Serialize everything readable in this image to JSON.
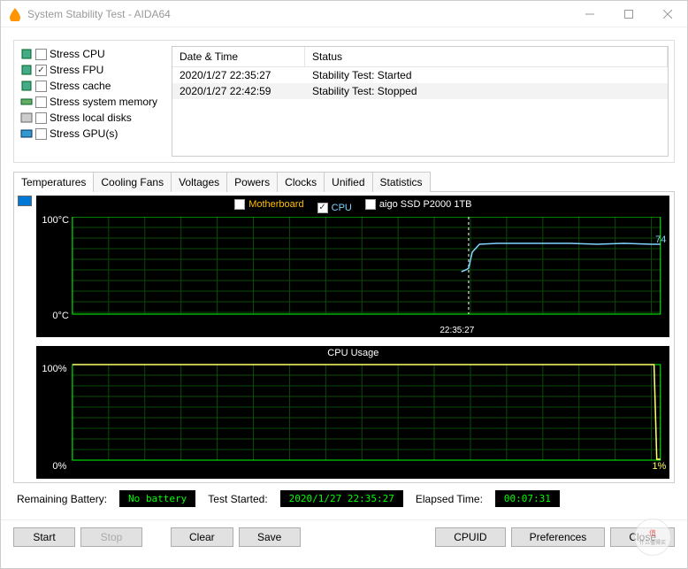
{
  "window": {
    "title": "System Stability Test - AIDA64"
  },
  "stress": {
    "items": [
      {
        "label": "Stress CPU",
        "checked": false
      },
      {
        "label": "Stress FPU",
        "checked": true
      },
      {
        "label": "Stress cache",
        "checked": false
      },
      {
        "label": "Stress system memory",
        "checked": false
      },
      {
        "label": "Stress local disks",
        "checked": false
      },
      {
        "label": "Stress GPU(s)",
        "checked": false
      }
    ]
  },
  "log": {
    "headers": {
      "date": "Date & Time",
      "status": "Status"
    },
    "rows": [
      {
        "date": "2020/1/27 22:35:27",
        "status": "Stability Test: Started"
      },
      {
        "date": "2020/1/27 22:42:59",
        "status": "Stability Test: Stopped"
      }
    ]
  },
  "tabs": [
    "Temperatures",
    "Cooling Fans",
    "Voltages",
    "Powers",
    "Clocks",
    "Unified",
    "Statistics"
  ],
  "temp_chart": {
    "legend": [
      {
        "label": "Motherboard",
        "checked": false,
        "color": "#ffc000"
      },
      {
        "label": "CPU",
        "checked": true,
        "color": "#7fd4ff"
      },
      {
        "label": "aigo SSD P2000 1TB",
        "checked": false,
        "color": "#ffffff"
      }
    ],
    "ylabel_top": "100°C",
    "ylabel_bot": "0°C",
    "marker_time": "22:35:27",
    "end_value": "74"
  },
  "usage_chart": {
    "title": "CPU Usage",
    "ylabel_top": "100%",
    "ylabel_bot": "0%",
    "end_value": "1%"
  },
  "status": {
    "battery_label": "Remaining Battery:",
    "battery_value": "No battery",
    "started_label": "Test Started:",
    "started_value": "2020/1/27 22:35:27",
    "elapsed_label": "Elapsed Time:",
    "elapsed_value": "00:07:31"
  },
  "buttons": {
    "start": "Start",
    "stop": "Stop",
    "clear": "Clear",
    "save": "Save",
    "cpuid": "CPUID",
    "preferences": "Preferences",
    "close": "Close"
  },
  "chart_data": [
    {
      "type": "line",
      "title": "Temperatures",
      "ylabel": "°C",
      "ylim": [
        0,
        100
      ],
      "x_marker": "22:35:27",
      "series": [
        {
          "name": "CPU",
          "final_value": 74,
          "plateau": 74,
          "pre_start_approx": 48
        }
      ],
      "legend": [
        "Motherboard",
        "CPU",
        "aigo SSD P2000 1TB"
      ]
    },
    {
      "type": "line",
      "title": "CPU Usage",
      "ylabel": "%",
      "ylim": [
        0,
        100
      ],
      "series": [
        {
          "name": "CPU Usage",
          "plateau": 100,
          "final_value": 1
        }
      ]
    }
  ]
}
